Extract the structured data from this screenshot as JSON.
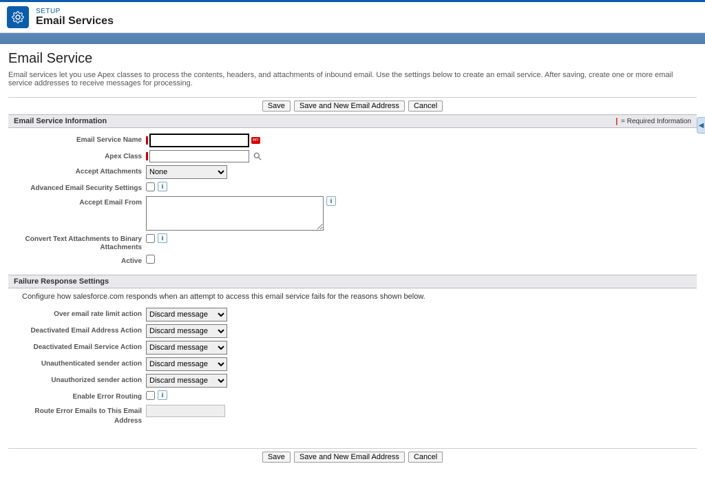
{
  "header": {
    "setup_label": "SETUP",
    "title": "Email Services"
  },
  "page": {
    "title": "Email Service",
    "description": "Email services let you use Apex classes to process the contents, headers, and attachments of inbound email. Use the settings below to create an email service. After saving, create one or more email service addresses to receive messages for processing."
  },
  "buttons": {
    "save": "Save",
    "save_new": "Save and New Email Address",
    "cancel": "Cancel"
  },
  "required_legend": "= Required Information",
  "sections": {
    "info_title": "Email Service Information",
    "failure_title": "Failure Response Settings",
    "failure_desc": "Configure how salesforce.com responds when an attempt to access this email service fails for the reasons shown below."
  },
  "labels": {
    "email_service_name": "Email Service Name",
    "apex_class": "Apex Class",
    "accept_attachments": "Accept Attachments",
    "advanced_security": "Advanced Email Security Settings",
    "accept_email_from": "Accept Email From",
    "convert_text": "Convert Text Attachments to Binary Attachments",
    "active": "Active",
    "over_rate": "Over email rate limit action",
    "deactivated_addr": "Deactivated Email Address Action",
    "deactivated_svc": "Deactivated Email Service Action",
    "unauth_sender": "Unauthenticated sender action",
    "unauthorized_sender": "Unauthorized sender action",
    "enable_error_routing": "Enable Error Routing",
    "route_error_emails": "Route Error Emails to This Email Address"
  },
  "values": {
    "email_service_name": "",
    "apex_class": "",
    "accept_attachments": "None",
    "advanced_security": false,
    "accept_email_from": "",
    "convert_text": false,
    "active": false,
    "over_rate": "Discard message",
    "deactivated_addr": "Discard message",
    "deactivated_svc": "Discard message",
    "unauth_sender": "Discard message",
    "unauthorized_sender": "Discard message",
    "enable_error_routing": false,
    "route_error_emails": ""
  },
  "options": {
    "accept_attachments": [
      "None"
    ],
    "fail_action": [
      "Discard message"
    ]
  }
}
